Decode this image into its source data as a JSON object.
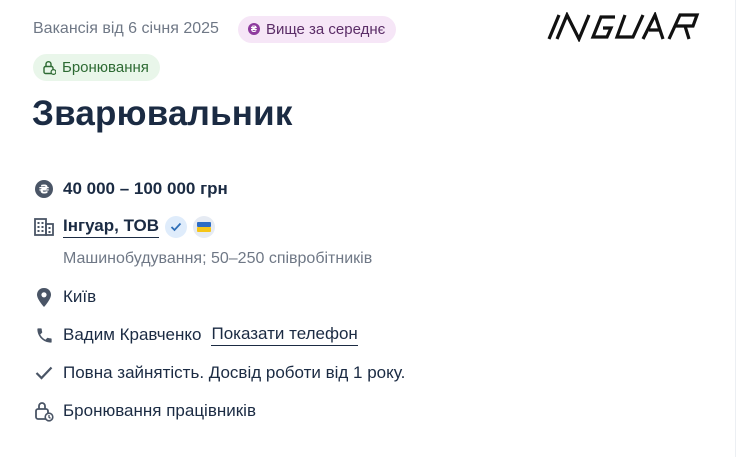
{
  "header": {
    "posted": "Вакансія від 6 січня 2025",
    "salary_badge": "Вище за середнє",
    "booking_badge": "Бронювання",
    "logo_text": "INGUAR"
  },
  "vacancy": {
    "title": "Зварювальник",
    "salary": "40 000 – 100 000 грн",
    "company_name": "Інгуар, ТОВ",
    "company_meta": "Машинобудування; 50–250 співробітників",
    "city": "Київ",
    "contact_name": "Вадим Кравченко",
    "show_phone": "Показати телефон",
    "employment": "Повна зайнятість. Досвід роботи від 1 року.",
    "reservation": "Бронювання працівників"
  },
  "icons": {
    "salary": "currency-icon",
    "company": "building-icon",
    "location": "pin-icon",
    "phone": "phone-icon",
    "employment": "check-icon",
    "reservation": "lock-icon"
  },
  "colors": {
    "text": "#1b2b43",
    "muted": "#6f7886",
    "salary_badge_bg": "#f6e6f7",
    "booking_badge_bg": "#e9f6ea"
  }
}
